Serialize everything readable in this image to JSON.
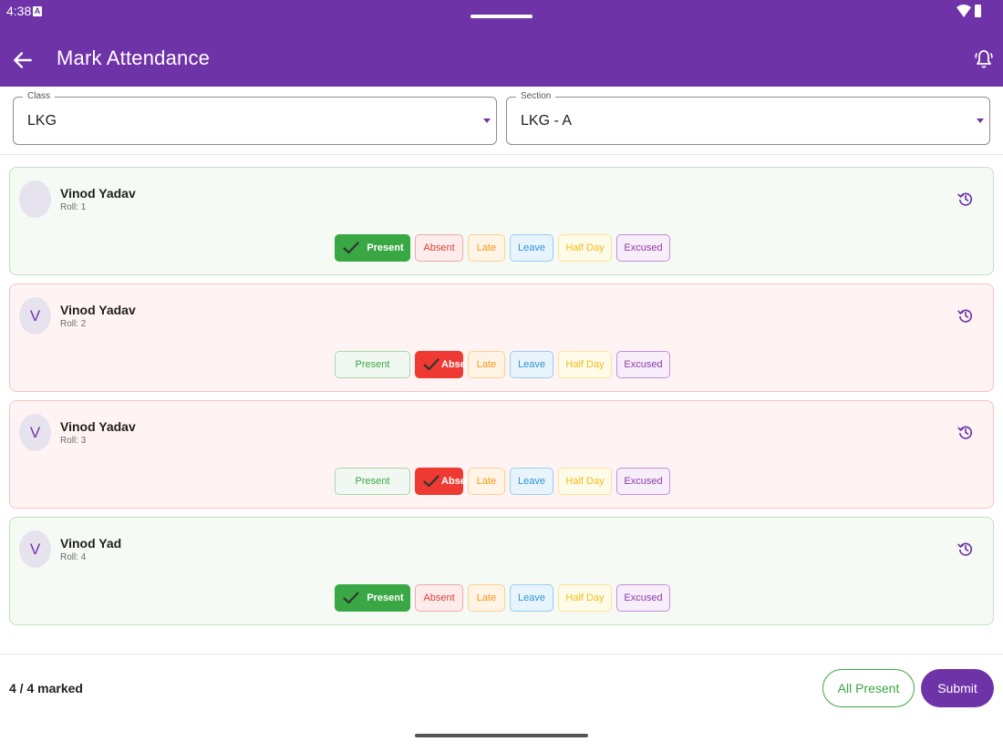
{
  "status_bar": {
    "time": "4:38",
    "notification_icon": "A"
  },
  "app_bar": {
    "title": "Mark Attendance",
    "back_icon": "arrow-left-icon",
    "alert_icon": "bell-alert-icon"
  },
  "filters": {
    "class": {
      "label": "Class",
      "value": "LKG"
    },
    "section": {
      "label": "Section",
      "value": "LKG - A"
    }
  },
  "status_options": [
    "Present",
    "Absent",
    "Late",
    "Leave",
    "Half Day",
    "Excused"
  ],
  "students": [
    {
      "avatar": "",
      "name": "Vinod Yadav",
      "roll": "Roll: 1",
      "status": "Present"
    },
    {
      "avatar": "V",
      "name": "Vinod Yadav",
      "roll": "Roll: 2",
      "status": "Absent"
    },
    {
      "avatar": "V",
      "name": "Vinod Yadav",
      "roll": "Roll: 3",
      "status": "Absent"
    },
    {
      "avatar": "V",
      "name": "Vinod Yad",
      "roll": "Roll: 4",
      "status": "Present"
    }
  ],
  "footer": {
    "marked": "4 / 4 marked",
    "all_present_label": "All Present",
    "submit_label": "Submit"
  },
  "colors": {
    "primary": "#6f33a8",
    "present": "#3aa745",
    "absent": "#ee3a32",
    "late": "#f29a1b",
    "leave": "#2d95d6",
    "half_day": "#f2bd1f",
    "excused": "#8d3ba8"
  }
}
